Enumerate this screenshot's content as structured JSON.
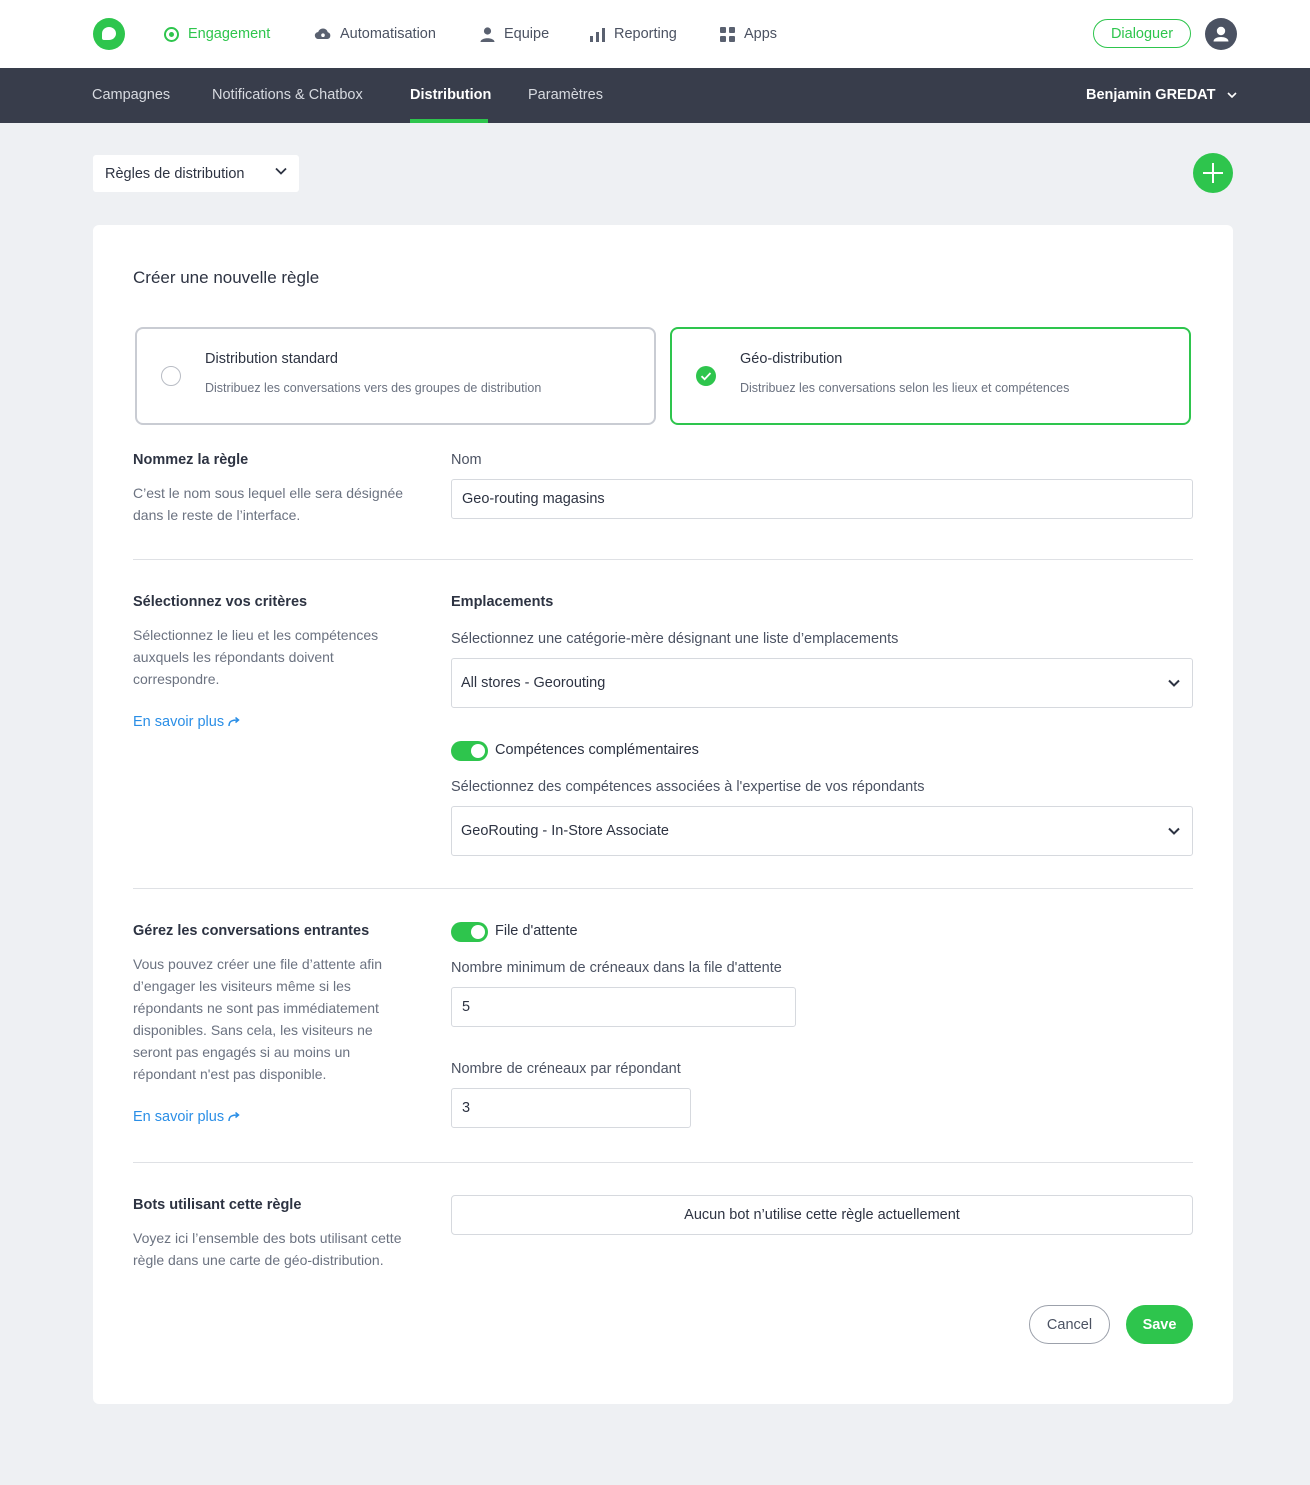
{
  "topnav": {
    "items": [
      {
        "label": "Engagement",
        "icon": "target-icon"
      },
      {
        "label": "Automatisation",
        "icon": "cloud-icon"
      },
      {
        "label": "Equipe",
        "icon": "person-icon"
      },
      {
        "label": "Reporting",
        "icon": "bar-chart-icon"
      },
      {
        "label": "Apps",
        "icon": "grid-icon"
      }
    ],
    "dialog_button": "Dialoguer"
  },
  "subnav": {
    "tabs": [
      {
        "label": "Campagnes"
      },
      {
        "label": "Notifications & Chatbox"
      },
      {
        "label": "Distribution"
      },
      {
        "label": "Paramètres"
      }
    ],
    "active_tab": "Distribution",
    "user_name": "Benjamin GREDAT"
  },
  "toolbar": {
    "rules_select": "Règles de distribution"
  },
  "form": {
    "title": "Créer une nouvelle règle",
    "options": [
      {
        "title": "Distribution standard",
        "description": "Distribuez les conversations vers des groupes de distribution",
        "selected": false
      },
      {
        "title": "Géo-distribution",
        "description": "Distribuez les conversations selon les lieux et compétences",
        "selected": true
      }
    ],
    "name_section": {
      "title": "Nommez la règle",
      "description": "C’est le nom sous lequel elle sera désignée dans le reste de l’interface.",
      "field_label": "Nom",
      "value": "Geo-routing magasins"
    },
    "criteria_section": {
      "title": "Sélectionnez vos critères",
      "description": "Sélectionnez le lieu et les compétences auxquels les répondants doivent correspondre.",
      "link": "En savoir plus",
      "locations_label": "Emplacements",
      "locations_help": "Sélectionnez une catégorie-mère désignant une liste d’emplacements",
      "locations_value": "All stores - Georouting",
      "skills_toggle_label": "Compétences complémentaires",
      "skills_enabled": true,
      "skills_help": "Sélectionnez des compétences associées à l'expertise de vos répondants",
      "skills_value": "GeoRouting - In-Store Associate"
    },
    "incoming_section": {
      "title": "Gérez les conversations entrantes",
      "description": "Vous pouvez créer une file d’attente afin d’engager les visiteurs même si les répondants ne sont pas immédiatement disponibles. Sans cela, les visiteurs ne seront pas engagés si au moins un répondant n'est pas disponible.",
      "link": "En savoir plus",
      "queue_toggle_label": "File d'attente",
      "queue_enabled": true,
      "min_slots_label": "Nombre minimum de créneaux dans la file d'attente",
      "min_slots_value": "5",
      "slots_per_agent_label": "Nombre de créneaux par répondant",
      "slots_per_agent_value": "3"
    },
    "bots_section": {
      "title": "Bots utilisant cette règle",
      "description": "Voyez ici l’ensemble des bots utilisant cette règle dans une carte de géo-distribution.",
      "empty_message": "Aucun bot n’utilise cette règle actuellement"
    },
    "cancel_button": "Cancel",
    "save_button": "Save"
  },
  "colors": {
    "brand_green": "#2ec54d",
    "subnav_bg": "#383d4b",
    "link_blue": "#2a8ee6",
    "page_bg": "#eef0f3"
  }
}
